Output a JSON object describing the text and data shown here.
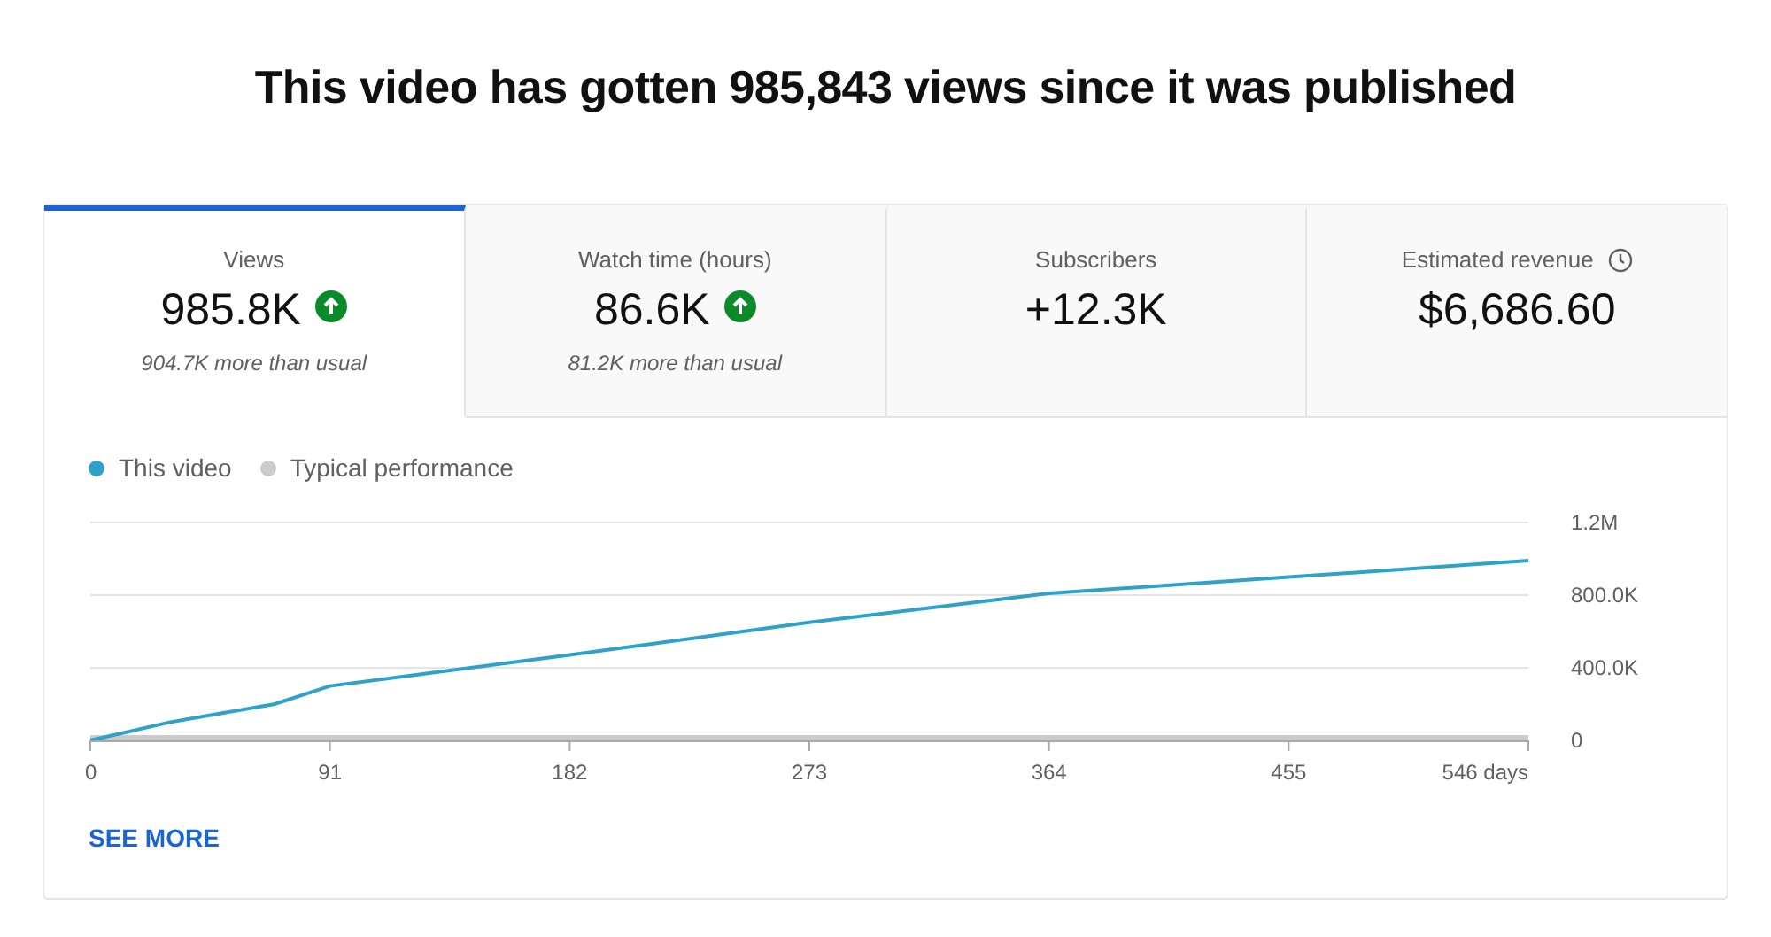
{
  "title": "This video has gotten 985,843 views since it was published",
  "tabs": [
    {
      "kind": "rising",
      "label": "Views",
      "value": "985.8K",
      "note": "904.7K more than usual",
      "selected": true
    },
    {
      "kind": "rising",
      "label": "Watch time (hours)",
      "value": "86.6K",
      "note": "81.2K more than usual",
      "selected": false
    },
    {
      "kind": "plain",
      "label": "Subscribers",
      "value": "+12.3K",
      "selected": false
    },
    {
      "kind": "estimated",
      "label": "Estimated revenue",
      "value": "$6,686.60",
      "selected": false
    }
  ],
  "chart_data": {
    "type": "line",
    "x": [
      0,
      30,
      70,
      91,
      182,
      273,
      364,
      455,
      546
    ],
    "xticks": [
      0,
      91,
      182,
      273,
      364,
      455,
      {
        "value": 546,
        "label": "546 days"
      }
    ],
    "yticks": [
      0,
      {
        "value": 400000,
        "label": "400.0K"
      },
      {
        "value": 800000,
        "label": "800.0K"
      },
      {
        "value": 1200000,
        "label": "1.2M"
      }
    ],
    "xlim": [
      0,
      546
    ],
    "ylim": [
      0,
      1200000
    ],
    "series": [
      {
        "name": "This video",
        "color": "#2ea2c8",
        "values": [
          0,
          100000,
          200000,
          300000,
          470000,
          650000,
          810000,
          900000,
          990000
        ]
      },
      {
        "name": "Typical performance",
        "color": "#cccccc",
        "values": [
          10000,
          10000,
          10000,
          10000,
          10000,
          10000,
          10000,
          10000,
          10000
        ]
      }
    ]
  },
  "see_more": "SEE MORE"
}
